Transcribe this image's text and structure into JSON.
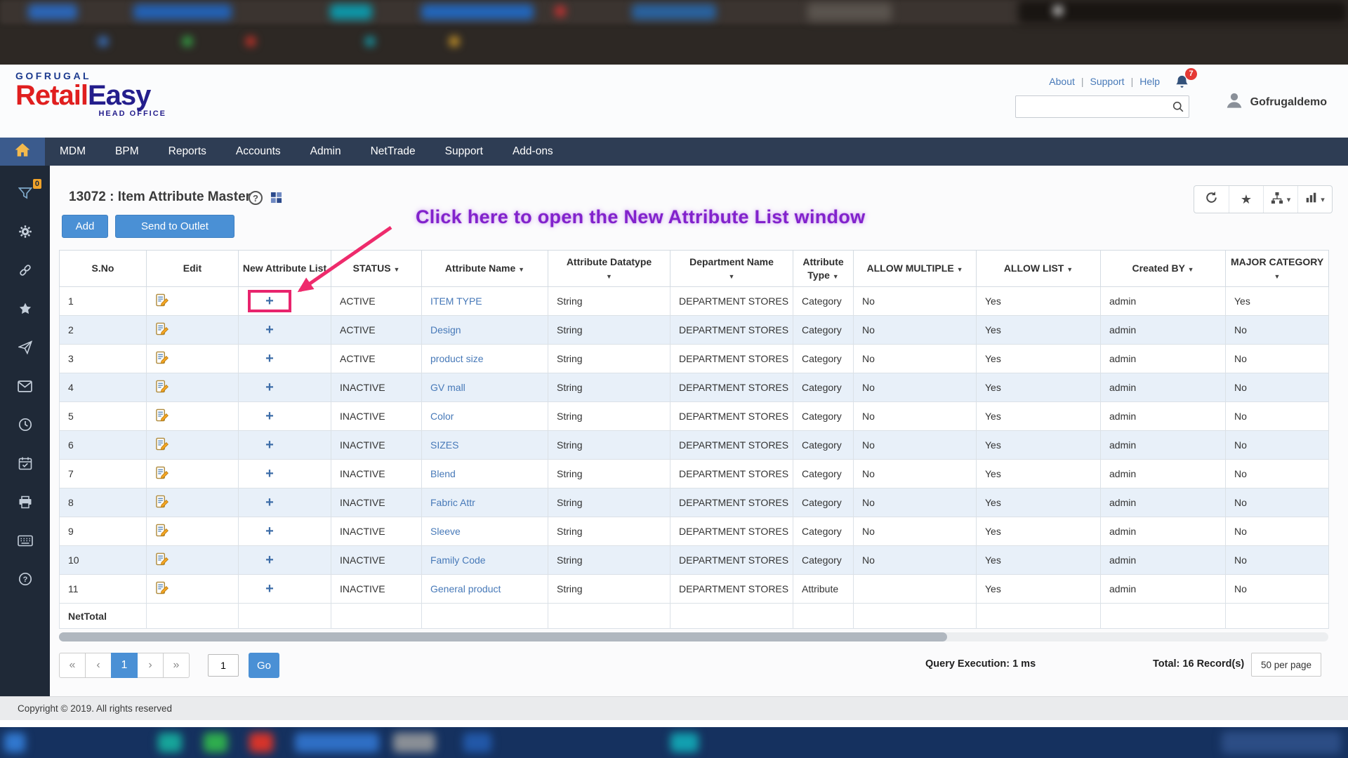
{
  "colors": {
    "accent_blue": "#4a90d5",
    "nav_bg": "#2e3d54",
    "sidebar_bg": "#1f2937",
    "link_blue": "#4779b8",
    "annotation_purple": "#8222cc",
    "highlight_pink": "#e8246d",
    "logo_red": "#e01f1f",
    "logo_navy": "#241e8c",
    "alt_row_blue": "#e8f0f9",
    "badge_red": "#e53935",
    "filter_badge_orange": "#f0a32a"
  },
  "header": {
    "logo_top": "GOFRUGAL",
    "logo_retail": "Retail",
    "logo_easy": "Easy",
    "logo_sub": "HEAD OFFICE",
    "links": [
      "About",
      "Support",
      "Help"
    ],
    "notification_count": "7",
    "username": "Gofrugaldemo",
    "search_value": ""
  },
  "nav": {
    "home_icon": "home-icon",
    "items": [
      "MDM",
      "BPM",
      "Reports",
      "Accounts",
      "Admin",
      "NetTrade",
      "Support",
      "Add-ons"
    ]
  },
  "sidebar": {
    "filter_badge": "0",
    "icons": [
      "filter-icon",
      "gear-icon",
      "link-icon",
      "star-icon",
      "send-icon",
      "mail-icon",
      "clock-icon",
      "calendar-icon",
      "print-icon",
      "keyboard-icon",
      "help-icon"
    ]
  },
  "page": {
    "title": "13072 : Item Attribute Master",
    "add_button": "Add",
    "send_button": "Send to Outlet",
    "annotation": "Click here to open the New Attribute List window",
    "toolbar_icons": [
      "refresh-icon",
      "star-icon",
      "sitemap-icon",
      "chart-icon"
    ]
  },
  "table": {
    "headers": [
      {
        "label": "S.No",
        "sortable": false
      },
      {
        "label": "Edit",
        "sortable": false
      },
      {
        "label": "New Attribute List",
        "sortable": false
      },
      {
        "label": "STATUS",
        "sortable": true
      },
      {
        "label": "Attribute Name",
        "sortable": true
      },
      {
        "label": "Attribute Datatype",
        "sortable": true,
        "caret_below": true
      },
      {
        "label": "Department Name",
        "sortable": true,
        "caret_below": true
      },
      {
        "label": "Attribute Type",
        "sortable": true
      },
      {
        "label": "ALLOW MULTIPLE",
        "sortable": true
      },
      {
        "label": "ALLOW LIST",
        "sortable": true
      },
      {
        "label": "Created BY",
        "sortable": true
      },
      {
        "label": "MAJOR CATEGORY",
        "sortable": true
      }
    ],
    "rows": [
      {
        "sno": "1",
        "status": "ACTIVE",
        "name": "ITEM TYPE",
        "datatype": "String",
        "department": "DEPARTMENT STORES",
        "type": "Category",
        "allow_multiple": "No",
        "allow_list": "Yes",
        "created_by": "admin",
        "major_category": "Yes",
        "highlight": true
      },
      {
        "sno": "2",
        "status": "ACTIVE",
        "name": "Design",
        "datatype": "String",
        "department": "DEPARTMENT STORES",
        "type": "Category",
        "allow_multiple": "No",
        "allow_list": "Yes",
        "created_by": "admin",
        "major_category": "No"
      },
      {
        "sno": "3",
        "status": "ACTIVE",
        "name": "product size",
        "datatype": "String",
        "department": "DEPARTMENT STORES",
        "type": "Category",
        "allow_multiple": "No",
        "allow_list": "Yes",
        "created_by": "admin",
        "major_category": "No"
      },
      {
        "sno": "4",
        "status": "INACTIVE",
        "name": "GV mall",
        "datatype": "String",
        "department": "DEPARTMENT STORES",
        "type": "Category",
        "allow_multiple": "No",
        "allow_list": "Yes",
        "created_by": "admin",
        "major_category": "No"
      },
      {
        "sno": "5",
        "status": "INACTIVE",
        "name": "Color",
        "datatype": "String",
        "department": "DEPARTMENT STORES",
        "type": "Category",
        "allow_multiple": "No",
        "allow_list": "Yes",
        "created_by": "admin",
        "major_category": "No"
      },
      {
        "sno": "6",
        "status": "INACTIVE",
        "name": "SIZES",
        "datatype": "String",
        "department": "DEPARTMENT STORES",
        "type": "Category",
        "allow_multiple": "No",
        "allow_list": "Yes",
        "created_by": "admin",
        "major_category": "No"
      },
      {
        "sno": "7",
        "status": "INACTIVE",
        "name": "Blend",
        "datatype": "String",
        "department": "DEPARTMENT STORES",
        "type": "Category",
        "allow_multiple": "No",
        "allow_list": "Yes",
        "created_by": "admin",
        "major_category": "No"
      },
      {
        "sno": "8",
        "status": "INACTIVE",
        "name": "Fabric Attr",
        "datatype": "String",
        "department": "DEPARTMENT STORES",
        "type": "Category",
        "allow_multiple": "No",
        "allow_list": "Yes",
        "created_by": "admin",
        "major_category": "No"
      },
      {
        "sno": "9",
        "status": "INACTIVE",
        "name": "Sleeve",
        "datatype": "String",
        "department": "DEPARTMENT STORES",
        "type": "Category",
        "allow_multiple": "No",
        "allow_list": "Yes",
        "created_by": "admin",
        "major_category": "No"
      },
      {
        "sno": "10",
        "status": "INACTIVE",
        "name": "Family Code",
        "datatype": "String",
        "department": "DEPARTMENT STORES",
        "type": "Category",
        "allow_multiple": "No",
        "allow_list": "Yes",
        "created_by": "admin",
        "major_category": "No"
      },
      {
        "sno": "11",
        "status": "INACTIVE",
        "name": "General product",
        "datatype": "String",
        "department": "DEPARTMENT STORES",
        "type": "Attribute",
        "allow_multiple": "",
        "allow_list": "Yes",
        "created_by": "admin",
        "major_category": "No"
      }
    ],
    "nettotal_label": "NetTotal"
  },
  "pagination": {
    "first": "«",
    "prev": "‹",
    "page": "1",
    "next": "›",
    "last": "»",
    "input_value": "1",
    "go_label": "Go",
    "query_execution": "Query Execution: 1 ms",
    "total": "Total: 16 Record(s)",
    "per_page": "50 per page"
  },
  "footer": {
    "copyright": "Copyright © 2019. All rights reserved"
  }
}
